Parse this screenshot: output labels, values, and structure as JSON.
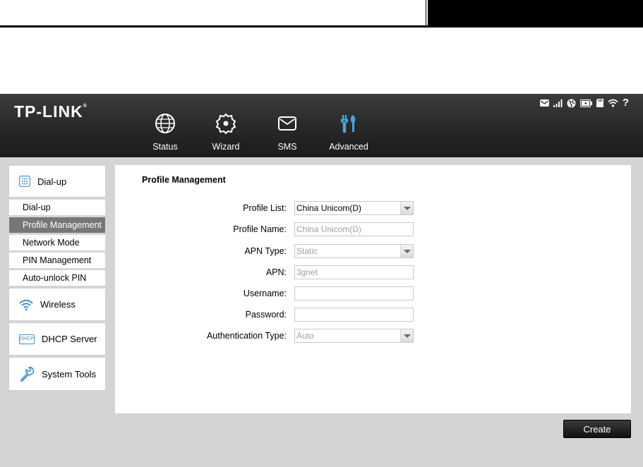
{
  "brand": {
    "logo": "TP-LINK",
    "logo_mark": "®"
  },
  "nav": [
    {
      "label": "Status",
      "icon": "globe-icon"
    },
    {
      "label": "Wizard",
      "icon": "wizard-gear-icon"
    },
    {
      "label": "SMS",
      "icon": "envelope-icon"
    },
    {
      "label": "Advanced",
      "icon": "tools-icon",
      "active_color": "#3fa9e6"
    }
  ],
  "status_icons": [
    "mail-icon",
    "signal-icon",
    "internet-globe-icon",
    "battery-icon",
    "sd-card-icon",
    "wifi-icon",
    "help-icon"
  ],
  "sidebar": {
    "dialup": {
      "label": "Dial-up",
      "icon": "dialpad-icon"
    },
    "dialup_items": [
      {
        "label": "Dial-up"
      },
      {
        "label": "Profile Management",
        "active": true
      },
      {
        "label": "Network Mode"
      },
      {
        "label": "PIN Management"
      },
      {
        "label": "Auto-unlock PIN"
      }
    ],
    "wireless": {
      "label": "Wireless",
      "icon": "wifi-icon"
    },
    "dhcp": {
      "label": "DHCP Server",
      "icon": "dhcp-icon",
      "icon_text": "DHCP"
    },
    "system": {
      "label": "System Tools",
      "icon": "wrench-icon"
    }
  },
  "form": {
    "title": "Profile Management",
    "profile_list": {
      "label": "Profile List:",
      "value": "China Unicom(D)"
    },
    "profile_name": {
      "label": "Profile Name:",
      "value": "China Unicom(D)"
    },
    "apn_type": {
      "label": "APN Type:",
      "value": "Static"
    },
    "apn": {
      "label": "APN:",
      "value": "3gnet"
    },
    "username": {
      "label": "Username:",
      "value": ""
    },
    "password": {
      "label": "Password:",
      "value": ""
    },
    "auth_type": {
      "label": "Authentication Type:",
      "value": "Auto"
    }
  },
  "buttons": {
    "create": "Create"
  },
  "colors": {
    "accent": "#3fa9e6",
    "topbar": "#2a2a2a",
    "active_menu": "#777777"
  }
}
